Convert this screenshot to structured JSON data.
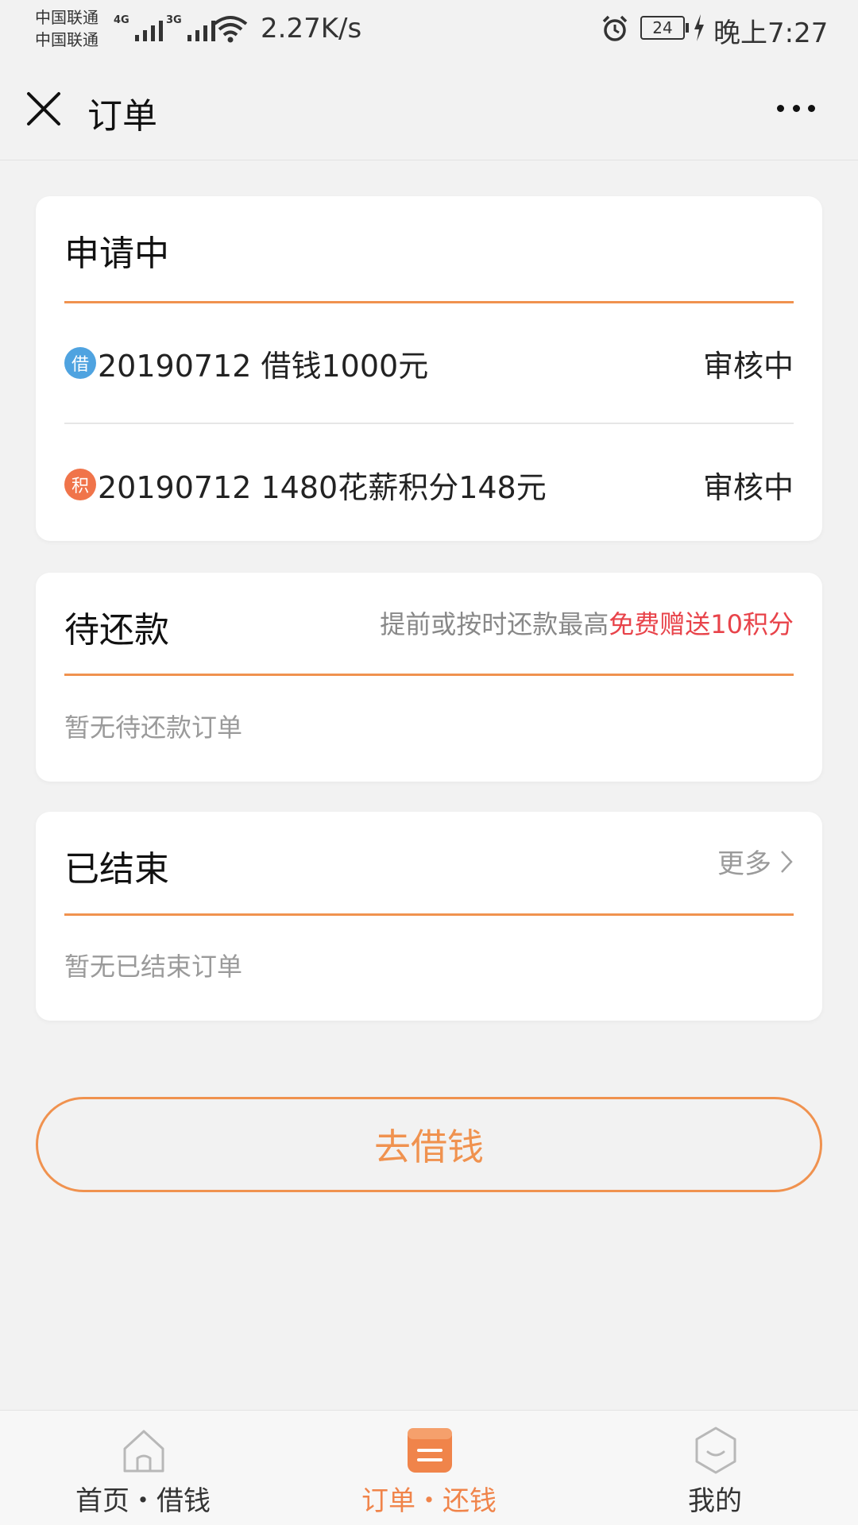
{
  "status_bar": {
    "carrier_1": "中国联通",
    "carrier_2": "中国联通",
    "net_1": "4G",
    "net_2": "3G",
    "net_speed": "2.27K/s",
    "battery": "24",
    "time": "晚上7:27"
  },
  "header": {
    "title": "订单"
  },
  "applying": {
    "title": "申请中",
    "orders": [
      {
        "badge": "借",
        "badge_color": "#4fa3e0",
        "text": "20190712 借钱1000元",
        "status": "审核中"
      },
      {
        "badge": "积",
        "badge_color": "#f0744a",
        "text": "20190712 1480花薪积分148元",
        "status": "审核中"
      }
    ]
  },
  "pending": {
    "title": "待还款",
    "hint_prefix": "提前或按时还款最高",
    "hint_highlight": "免费赠送10积分",
    "empty_text": "暂无待还款订单"
  },
  "finished": {
    "title": "已结束",
    "more_label": "更多",
    "empty_text": "暂无已结束订单"
  },
  "borrow_button": "去借钱",
  "tabs": [
    {
      "label": "首页・借钱",
      "icon": "home-icon",
      "active": false
    },
    {
      "label": "订单・还钱",
      "icon": "orders-icon",
      "active": true
    },
    {
      "label": "我的",
      "icon": "profile-smile-icon",
      "active": false
    }
  ],
  "colors": {
    "accent": "#f0924f",
    "highlight_red": "#e8434a",
    "badge_blue": "#4fa3e0",
    "badge_orange": "#f0744a"
  }
}
